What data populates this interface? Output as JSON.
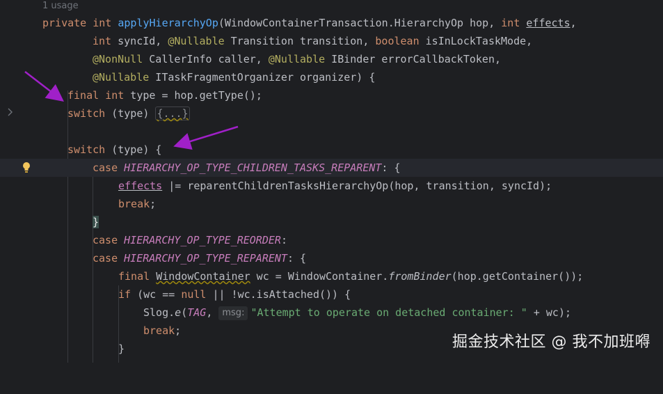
{
  "usage_hint": "1 usage",
  "code": {
    "l1": {
      "kw_private": "private",
      "kw_int": "int",
      "method": "applyHierarchyOp",
      "p1": "(WindowContainerTransaction.HierarchyOp hop, ",
      "kw_int2": "int",
      "sp": " ",
      "effects": "effects",
      "comma": ","
    },
    "l2": {
      "kw_int": "int",
      "p1": " syncId, ",
      "ann1": "@Nullable",
      "p2": " Transition transition, ",
      "kw_bool": "boolean",
      "p3": " isInLockTaskMode,"
    },
    "l3": {
      "ann1": "@NonNull",
      "p1": " CallerInfo caller, ",
      "ann2": "@Nullable",
      "p2": " IBinder errorCallbackToken,"
    },
    "l4": {
      "ann1": "@Nullable",
      "p1": " ITaskFragmentOrganizer organizer) {"
    },
    "l5": {
      "kw_final": "final",
      "kw_int": "int",
      "p1": " type = hop.getType();"
    },
    "l6": {
      "kw_switch": "switch",
      "p1": " (type) ",
      "fold": "{...}"
    },
    "l8": {
      "kw_switch": "switch",
      "p1": " (type) {"
    },
    "l9": {
      "kw_case": "case",
      "const": "HIERARCHY_OP_TYPE_CHILDREN_TASKS_REPARENT",
      "p1": ": ",
      "brace": "{"
    },
    "l10": {
      "field": "effects",
      "p1": " |= reparentChildrenTasksHierarchyOp(hop, transition, syncId);"
    },
    "l11": {
      "kw_break": "break",
      "p1": ";"
    },
    "l12": {
      "brace": "}"
    },
    "l13": {
      "kw_case": "case",
      "const": "HIERARCHY_OP_TYPE_REORDER",
      "p1": ":"
    },
    "l14": {
      "kw_case": "case",
      "const": "HIERARCHY_OP_TYPE_REPARENT",
      "p1": ": {"
    },
    "l15": {
      "kw_final": "final",
      "type": "WindowContainer",
      "p1": " wc = WindowContainer.",
      "static": "fromBinder",
      "p2": "(hop.getContainer());"
    },
    "l16": {
      "kw_if": "if",
      "p1": " (wc == ",
      "kw_null": "null",
      "p2": " || !wc.isAttached()) {"
    },
    "l17": {
      "p1": "Slog.",
      "static": "e",
      "p2": "(",
      "const": "TAG",
      "p3": ", ",
      "hint": "msg:",
      "str": "\"Attempt to operate on detached container: \"",
      "p4": " + wc);"
    },
    "l18": {
      "kw_break": "break",
      "p1": ";"
    },
    "l19": {
      "p1": "}"
    }
  },
  "gutter": {
    "fold_icon": "chevron-right-icon",
    "intention_icon": "lightbulb-icon"
  },
  "annotations": {
    "arrow_color": "#a020c8"
  },
  "watermark": "掘金技术社区 @ 我不加班嘚"
}
